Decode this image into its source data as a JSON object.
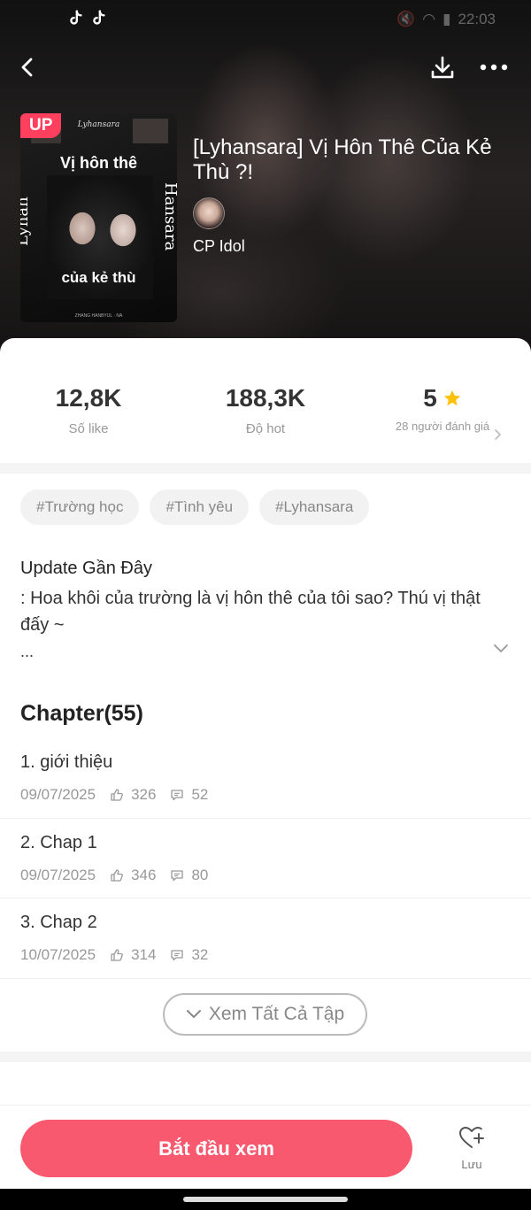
{
  "status_bar": {
    "time": "22:03",
    "icons": [
      "tiktok-icon",
      "mute-icon",
      "wifi-icon",
      "signal-icon"
    ]
  },
  "header": {
    "icons": [
      "back-arrow-icon",
      "download-icon",
      "more-dots-icon"
    ]
  },
  "book": {
    "badge": "UP",
    "title": "[Lyhansara] Vị Hôn Thê Của Kẻ Thù ?!",
    "author": "CP Idol",
    "cover": {
      "top_text": "Lyhansara",
      "title_line1": "Vị hôn thê",
      "title_line2": "của kẻ thù",
      "side_left": "Lyhan",
      "side_right": "Hansara",
      "bottom_text": "ZHANG HANBYUL · NA"
    }
  },
  "stats": {
    "likes": {
      "value": "12,8K",
      "label": "Số like"
    },
    "hot": {
      "value": "188,3K",
      "label": "Độ hot"
    },
    "rating": {
      "value": "5",
      "label": "28 người đánh giá",
      "star_color": "#FFC107"
    }
  },
  "tags": [
    "#Trường học",
    "#Tình yêu",
    "#Lyhansara"
  ],
  "update": {
    "title": "Update Gần Đây",
    "text": ": Hoa khôi của trường là vị hôn thê của tôi sao? Thú vị thật đấy ~",
    "more": "..."
  },
  "chapters": {
    "heading": "Chapter(55)",
    "items": [
      {
        "name": "1. giới thiệu",
        "date": "09/07/2025",
        "likes": "326",
        "comments": "52"
      },
      {
        "name": "2. Chap 1",
        "date": "09/07/2025",
        "likes": "346",
        "comments": "80"
      },
      {
        "name": "3. Chap 2",
        "date": "10/07/2025",
        "likes": "314",
        "comments": "32"
      }
    ],
    "view_all": "Xem Tất Cả Tập"
  },
  "bottom": {
    "start_label": "Bắt đầu xem",
    "save_label": "Lưu",
    "accent": "#F9596F"
  }
}
